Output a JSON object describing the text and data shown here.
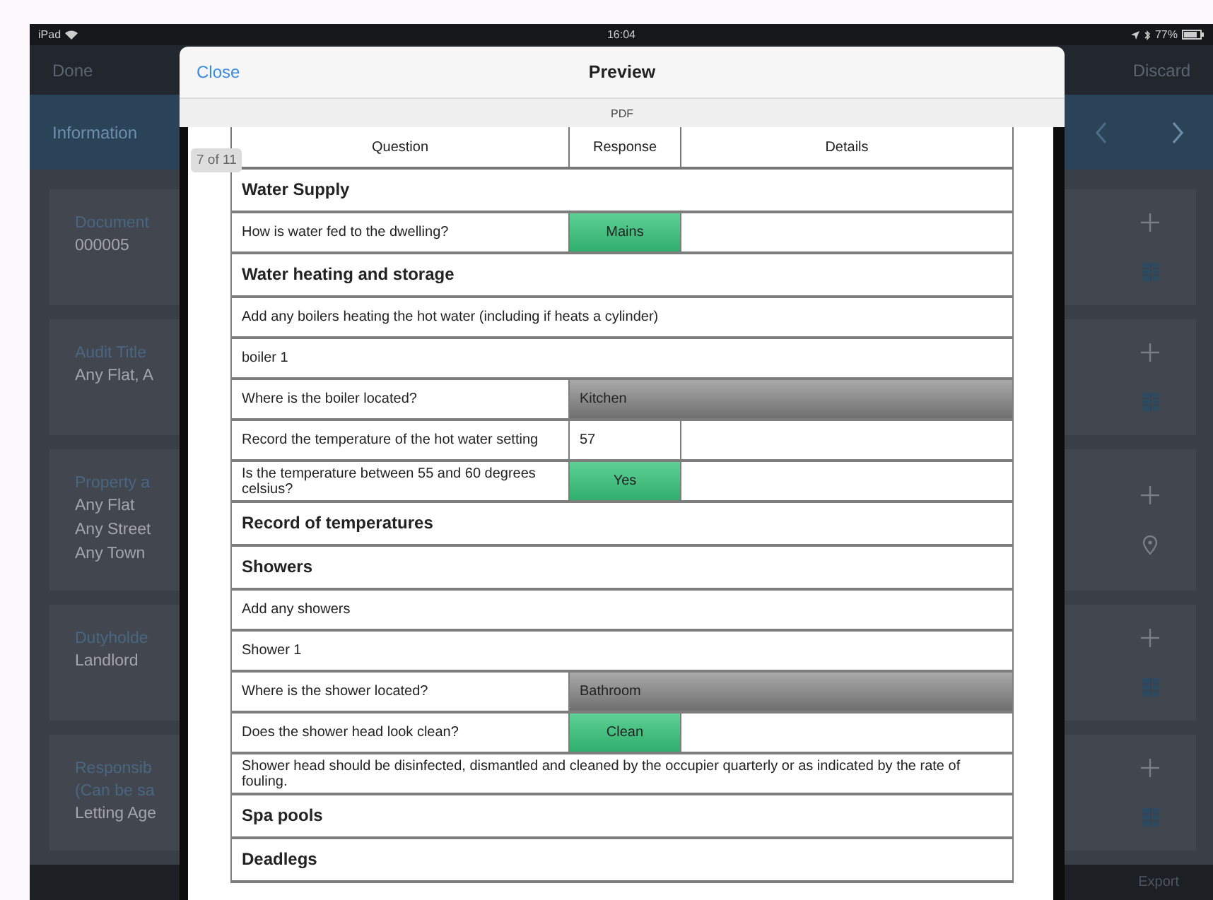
{
  "status_bar": {
    "device": "iPad",
    "time": "16:04",
    "battery": "77%"
  },
  "nav": {
    "left": "Done",
    "right": "Discard"
  },
  "section_header": {
    "title": "Information"
  },
  "cards": [
    {
      "label": [
        "Document"
      ],
      "values": [
        "000005"
      ],
      "kind": "list"
    },
    {
      "label": [
        "Audit Title"
      ],
      "values": [
        "Any Flat, A"
      ],
      "kind": "list"
    },
    {
      "label": [
        "Property a"
      ],
      "values": [
        "Any Flat",
        "Any Street",
        "Any Town"
      ],
      "kind": "location"
    },
    {
      "label": [
        "Dutyholde"
      ],
      "values": [
        "Landlord"
      ],
      "kind": "list"
    },
    {
      "label": [
        "Responsib",
        "(Can be sa"
      ],
      "values": [
        "Letting Age"
      ],
      "kind": "list"
    }
  ],
  "bottom_bar": {
    "action": "Export"
  },
  "modal": {
    "close": "Close",
    "title": "Preview",
    "subtitle": "PDF",
    "page_badge": "7 of 11",
    "table": {
      "columns": [
        "Question",
        "Response",
        "Details"
      ],
      "rows": [
        {
          "kind": "section",
          "text": "Water Supply"
        },
        {
          "kind": "question",
          "text": "How is water fed to the dwelling?",
          "response": {
            "kind": "button",
            "text": "Mains"
          }
        },
        {
          "kind": "section",
          "text": "Water heating and storage"
        },
        {
          "kind": "note",
          "text": "Add any boilers heating the hot water (including if heats a cylinder)"
        },
        {
          "kind": "note",
          "text": "boiler 1"
        },
        {
          "kind": "question",
          "text": "Where is the boiler located?",
          "response": {
            "kind": "dropdown",
            "text": "Kitchen"
          }
        },
        {
          "kind": "question",
          "text": "Record the temperature of the hot water setting",
          "response": {
            "kind": "text",
            "text": "57"
          }
        },
        {
          "kind": "question",
          "text": "Is the temperature between 55 and 60 degrees celsius?",
          "response": {
            "kind": "button",
            "text": "Yes"
          }
        },
        {
          "kind": "section",
          "text": "Record of temperatures"
        },
        {
          "kind": "section",
          "text": "Showers"
        },
        {
          "kind": "note",
          "text": "Add any showers"
        },
        {
          "kind": "note",
          "text": "Shower 1"
        },
        {
          "kind": "question",
          "text": "Where is the shower located?",
          "response": {
            "kind": "dropdown",
            "text": "Bathroom"
          }
        },
        {
          "kind": "question",
          "text": "Does the shower head look clean?",
          "response": {
            "kind": "button",
            "text": "Clean"
          }
        },
        {
          "kind": "note",
          "text": "Shower head should be disinfected, dismantled and cleaned by the occupier quarterly or as indicated by the rate of fouling."
        },
        {
          "kind": "section",
          "text": "Spa pools"
        },
        {
          "kind": "section",
          "text": "Deadlegs"
        }
      ]
    }
  }
}
